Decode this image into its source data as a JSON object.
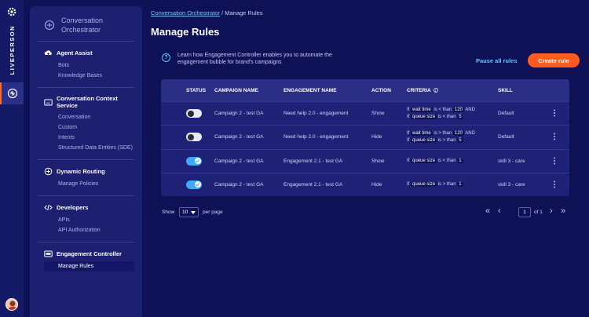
{
  "rail": {
    "brand": "LIVEPERSON",
    "icons": [
      "gear-icon",
      "brain-icon",
      "avatar"
    ]
  },
  "sidebar": {
    "header": {
      "line1": "Conversation",
      "line2": "Orchestrator"
    },
    "sections": [
      {
        "title": "Agent Assist",
        "icon": "cloud-upload-icon",
        "items": [
          "Bots",
          "Knowledge Bases"
        ]
      },
      {
        "title": "Conversation Context Service",
        "icon": "cc-icon",
        "items": [
          "Conversation",
          "Custom",
          "Intents",
          "Structured Data Entities (SDE)"
        ]
      },
      {
        "title": "Dynamic Routing",
        "icon": "brain-icon",
        "items": [
          "Manage Policies"
        ]
      },
      {
        "title": "Developers",
        "icon": "code-icon",
        "items": [
          "APIs",
          "API Authorization"
        ]
      },
      {
        "title": "Engagement Controller",
        "icon": "ec-icon",
        "items": [
          "Manage Rules"
        ]
      }
    ]
  },
  "breadcrumb": {
    "link": "Conversation Orchestrator",
    "separator": "/",
    "current": "Manage Rules"
  },
  "page_title": "Manage Rules",
  "info": {
    "text": "Learn how Engagement Controller enables you to automate the engagement bubble for brand's campaigns",
    "pause_all": "Pause all rules",
    "create_rule": "Create rule"
  },
  "table": {
    "headers": {
      "status": "STATUS",
      "campaign": "CAMPAIGN NAME",
      "engagement": "ENGAGEMENT NAME",
      "action": "ACTION",
      "criteria": "CRITERIA",
      "skill": "SKILL"
    },
    "rows": [
      {
        "enabled": false,
        "campaign": "Campaign 2 - test GA",
        "engagement": "Need help 2.0 - engagement",
        "action": "Show",
        "criteria": [
          {
            "prefix": "If",
            "field": "wait time",
            "op": "is < than",
            "value": "120",
            "suffix": "AND"
          },
          {
            "prefix": "If",
            "field": "queue size",
            "op": "is < than",
            "value": "5",
            "suffix": ""
          }
        ],
        "skill": "Default"
      },
      {
        "enabled": false,
        "campaign": "Campaign 2 - test GA",
        "engagement": "Need help 2.0 - engagement",
        "action": "Hide",
        "criteria": [
          {
            "prefix": "If",
            "field": "wait time",
            "op": "is > than",
            "value": "120",
            "suffix": "AND"
          },
          {
            "prefix": "If",
            "field": "queue size",
            "op": "is > than",
            "value": "5",
            "suffix": ""
          }
        ],
        "skill": "Default"
      },
      {
        "enabled": true,
        "campaign": "Campaign 2 - test GA",
        "engagement": "Engagement 2.1 - test GA",
        "action": "Show",
        "criteria": [
          {
            "prefix": "If",
            "field": "queue size",
            "op": "is < than",
            "value": "1",
            "suffix": ""
          }
        ],
        "skill": "skill 3 - care"
      },
      {
        "enabled": true,
        "campaign": "Campaign 2 - test GA",
        "engagement": "Engagement 2.1 - test GA",
        "action": "Hide",
        "criteria": [
          {
            "prefix": "If",
            "field": "queue size",
            "op": "is > than",
            "value": "1",
            "suffix": ""
          }
        ],
        "skill": "skill 3 - care"
      }
    ]
  },
  "pagination": {
    "show": "Show",
    "per_page_value": "10",
    "per_page": "per page",
    "page": "1",
    "of": "of 1"
  },
  "colors": {
    "background": "#0f1157",
    "accent": "#ff5b1f",
    "link": "#5cc8ff",
    "toggle_on": "#3ea9ff"
  }
}
